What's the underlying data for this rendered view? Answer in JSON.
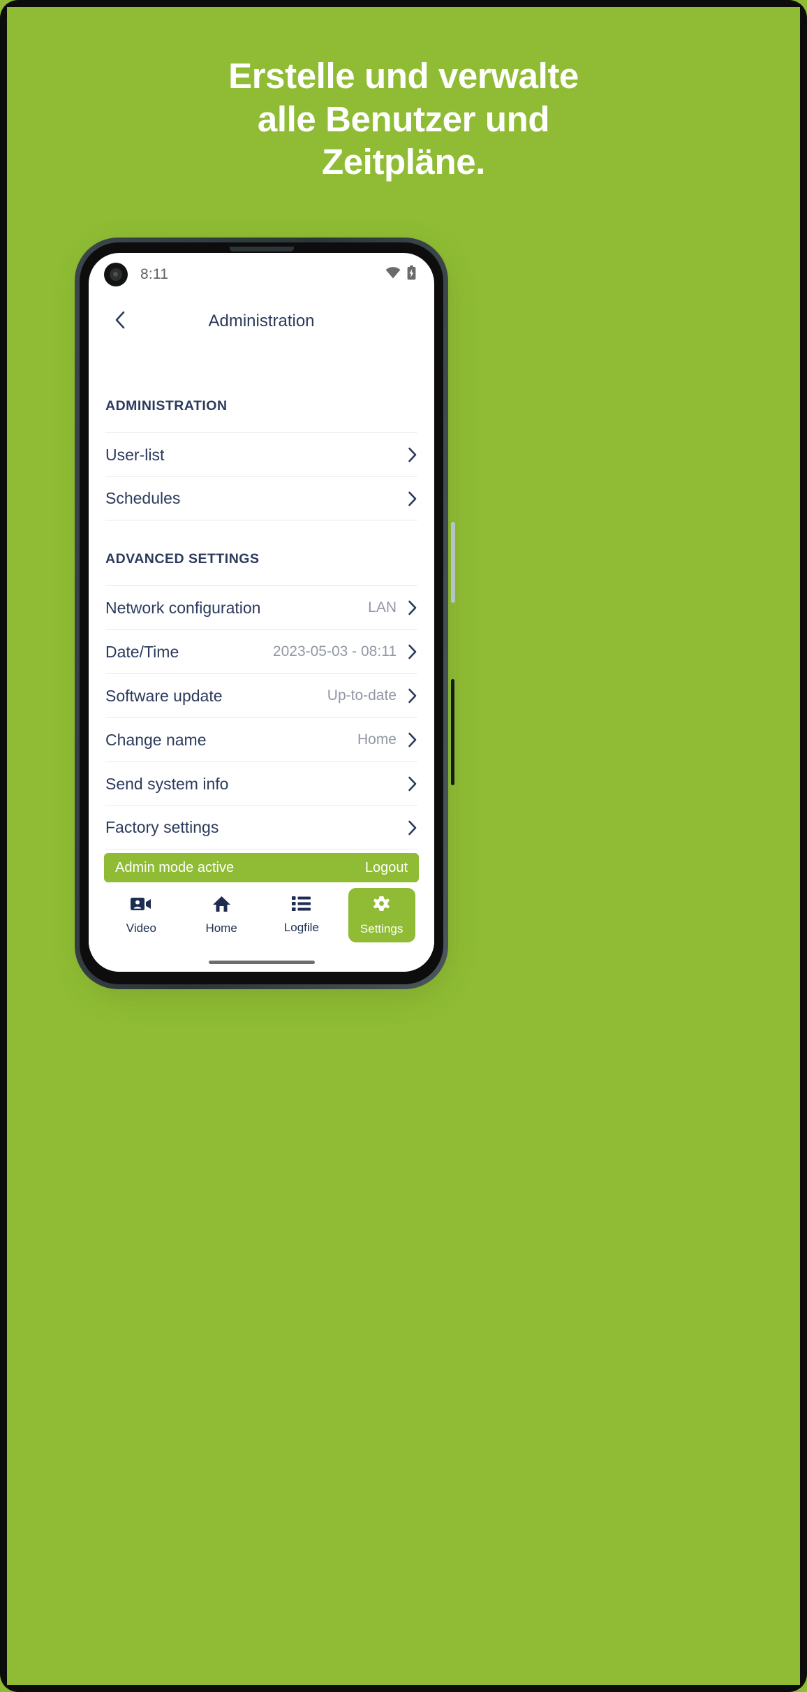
{
  "poster": {
    "background_color": "#8fbc34",
    "headline_lines": [
      "Erstelle und verwalte",
      "alle Benutzer und",
      "Zeitpläne."
    ]
  },
  "phone": {
    "statusbar": {
      "time": "8:11",
      "icons": [
        "wifi-icon",
        "battery-charging-icon"
      ]
    },
    "navbar": {
      "back_icon": "chevron-left-icon",
      "title": "Administration"
    },
    "sections": [
      {
        "header": "ADMINISTRATION",
        "rows": [
          {
            "label": "User-list",
            "value": ""
          },
          {
            "label": "Schedules",
            "value": ""
          }
        ]
      },
      {
        "header": "ADVANCED SETTINGS",
        "rows": [
          {
            "label": "Network configuration",
            "value": "LAN"
          },
          {
            "label": "Date/Time",
            "value": "2023-05-03 - 08:11"
          },
          {
            "label": "Software update",
            "value": "Up-to-date"
          },
          {
            "label": "Change name",
            "value": "Home"
          },
          {
            "label": "Send system info",
            "value": ""
          },
          {
            "label": "Factory settings",
            "value": ""
          }
        ]
      }
    ],
    "admin_banner": {
      "status_text": "Admin mode active",
      "logout_label": "Logout",
      "color": "#8fbc34"
    },
    "tabbar": {
      "active_color": "#8fbc34",
      "inactive_color": "#1d2d50",
      "tabs": [
        {
          "label": "Video",
          "icon": "video-camera-person-icon",
          "active": false
        },
        {
          "label": "Home",
          "icon": "home-icon",
          "active": false
        },
        {
          "label": "Logfile",
          "icon": "list-icon",
          "active": false
        },
        {
          "label": "Settings",
          "icon": "gear-icon",
          "active": true
        }
      ]
    }
  }
}
